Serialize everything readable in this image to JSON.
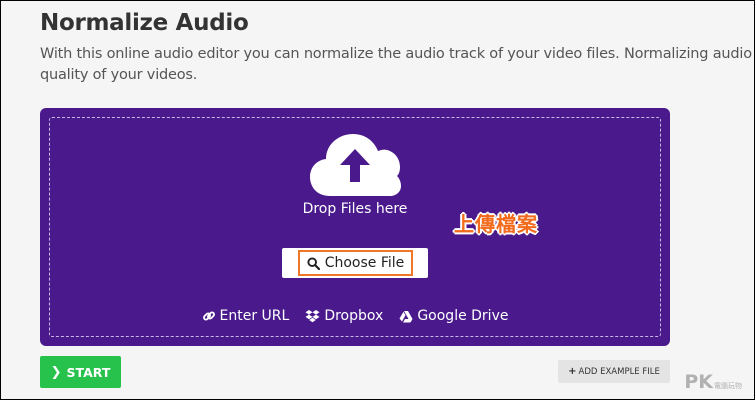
{
  "page": {
    "title": "Normalize Audio",
    "description_line1": "With this online audio editor you can normalize the audio track of your video files. Normalizing audio helps",
    "description_line2": "quality of your videos."
  },
  "upload": {
    "drop_text": "Drop Files here",
    "choose_label": "Choose File",
    "annotation": "上傳檔案",
    "sources": [
      {
        "label": "Enter URL",
        "icon": "link-icon"
      },
      {
        "label": "Dropbox",
        "icon": "dropbox-icon"
      },
      {
        "label": "Google Drive",
        "icon": "google-drive-icon"
      }
    ]
  },
  "actions": {
    "start_label": "START",
    "example_label": "ADD EXAMPLE FILE"
  },
  "watermark": {
    "text": "PK",
    "small": "電腦玩物"
  },
  "colors": {
    "upload_bg": "#4a1a8c",
    "start": "#27c24c",
    "highlight": "#f07628"
  }
}
